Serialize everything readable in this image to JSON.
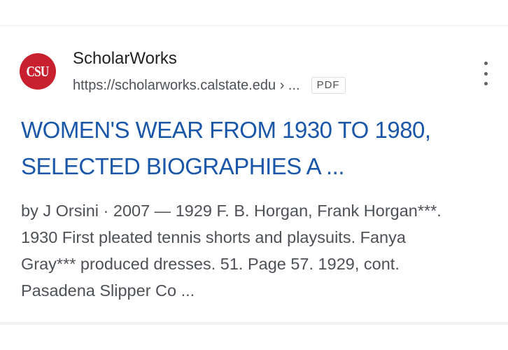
{
  "result": {
    "favicon_text": "CSU",
    "site_name": "ScholarWorks",
    "url": "https://scholarworks.calstate.edu › ...",
    "file_type": "PDF",
    "title_line1": "WOMEN'S WEAR FROM 1930 TO 1980,",
    "title_line2": "SELECTED BIOGRAPHIES A ...",
    "snippet_lines": [
      "by J Orsini · 2007 — 1929 F. B. Horgan, Frank Horgan***.",
      "1930 First pleated tennis shorts and playsuits. Fanya",
      "Gray*** produced dresses. 51. Page 57. 1929, cont.",
      "Pasadena Slipper Co ..."
    ]
  },
  "icons": {
    "more_options": "more-vert-icon"
  },
  "colors": {
    "favicon_bg": "#c8202f",
    "title_link": "#1a57a9",
    "site_name": "#202124",
    "secondary_text": "#4d5156"
  }
}
